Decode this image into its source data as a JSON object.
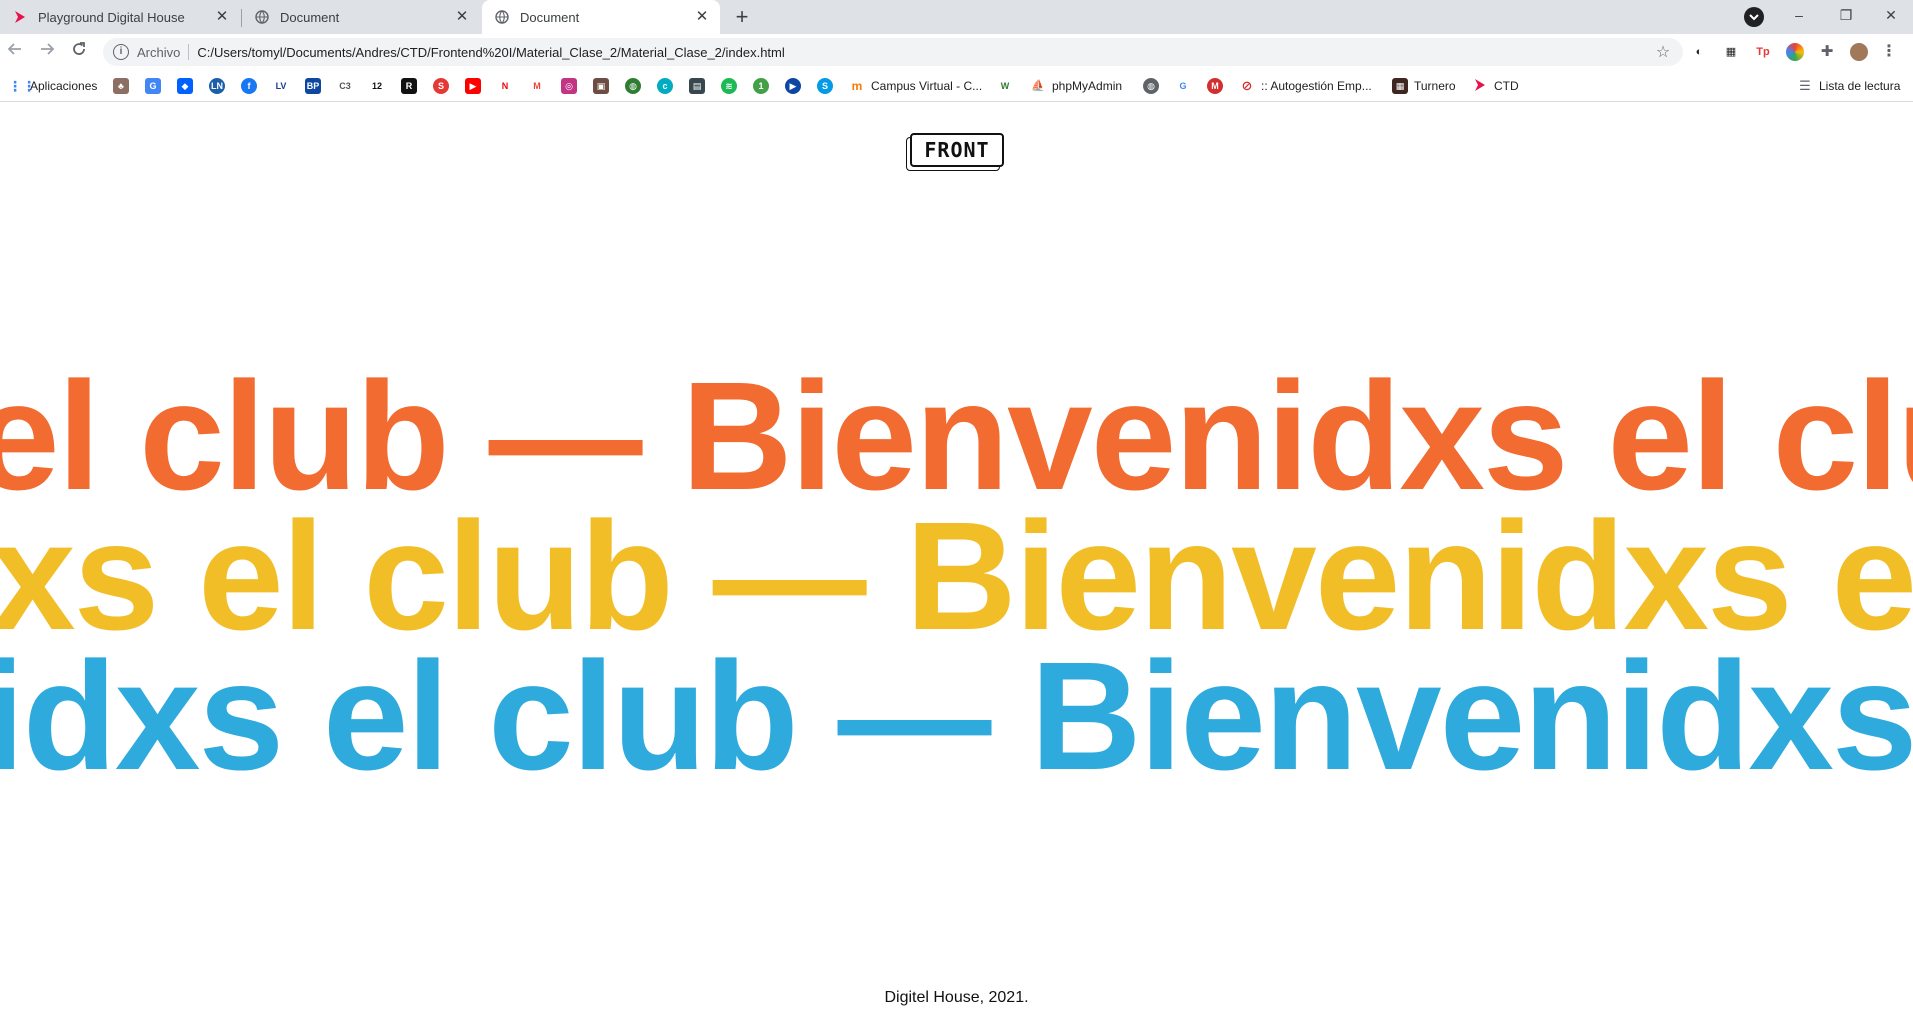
{
  "browser": {
    "tabs": [
      {
        "title": "Playground Digital House",
        "close": "✕"
      },
      {
        "title": "Document",
        "close": "✕"
      },
      {
        "title": "Document",
        "close": "✕"
      }
    ],
    "new_tab": "+",
    "window_controls": {
      "minimize": "–",
      "restore": "❐",
      "close": "✕"
    },
    "address": {
      "scheme_label": "Archivo",
      "url": "C:/Users/tomyl/Documents/Andres/CTD/Frontend%20I/Material_Clase_2/Material_Clase_2/index.html"
    },
    "bookmarks": [
      {
        "label": "Aplicaciones",
        "icon": "apps-grid-icon"
      },
      {
        "label": "Campus Virtual - C...",
        "icon": "moodle-icon"
      },
      {
        "label": "phpMyAdmin",
        "icon": "phpmyadmin-icon"
      },
      {
        "label": ":: Autogestión Emp...",
        "icon": "autogestion-icon"
      },
      {
        "label": "Turnero",
        "icon": "turnero-icon"
      },
      {
        "label": "CTD",
        "icon": "ctd-icon"
      }
    ],
    "reading_list": "Lista de lectura"
  },
  "page": {
    "logo_text": "FRONT",
    "marquee": [
      {
        "text": "el club — Bienvenidxs el club — Bienvenidxs",
        "color": "#f26b30"
      },
      {
        "text": "xs el club — Bienvenidxs el club — Bienvenidxs",
        "color": "#f2be28"
      },
      {
        "text": "idxs el club — Bienvenidxs el club — Bienvenidxs",
        "color": "#2faadd"
      }
    ],
    "footer": "Digitel House, 2021."
  }
}
